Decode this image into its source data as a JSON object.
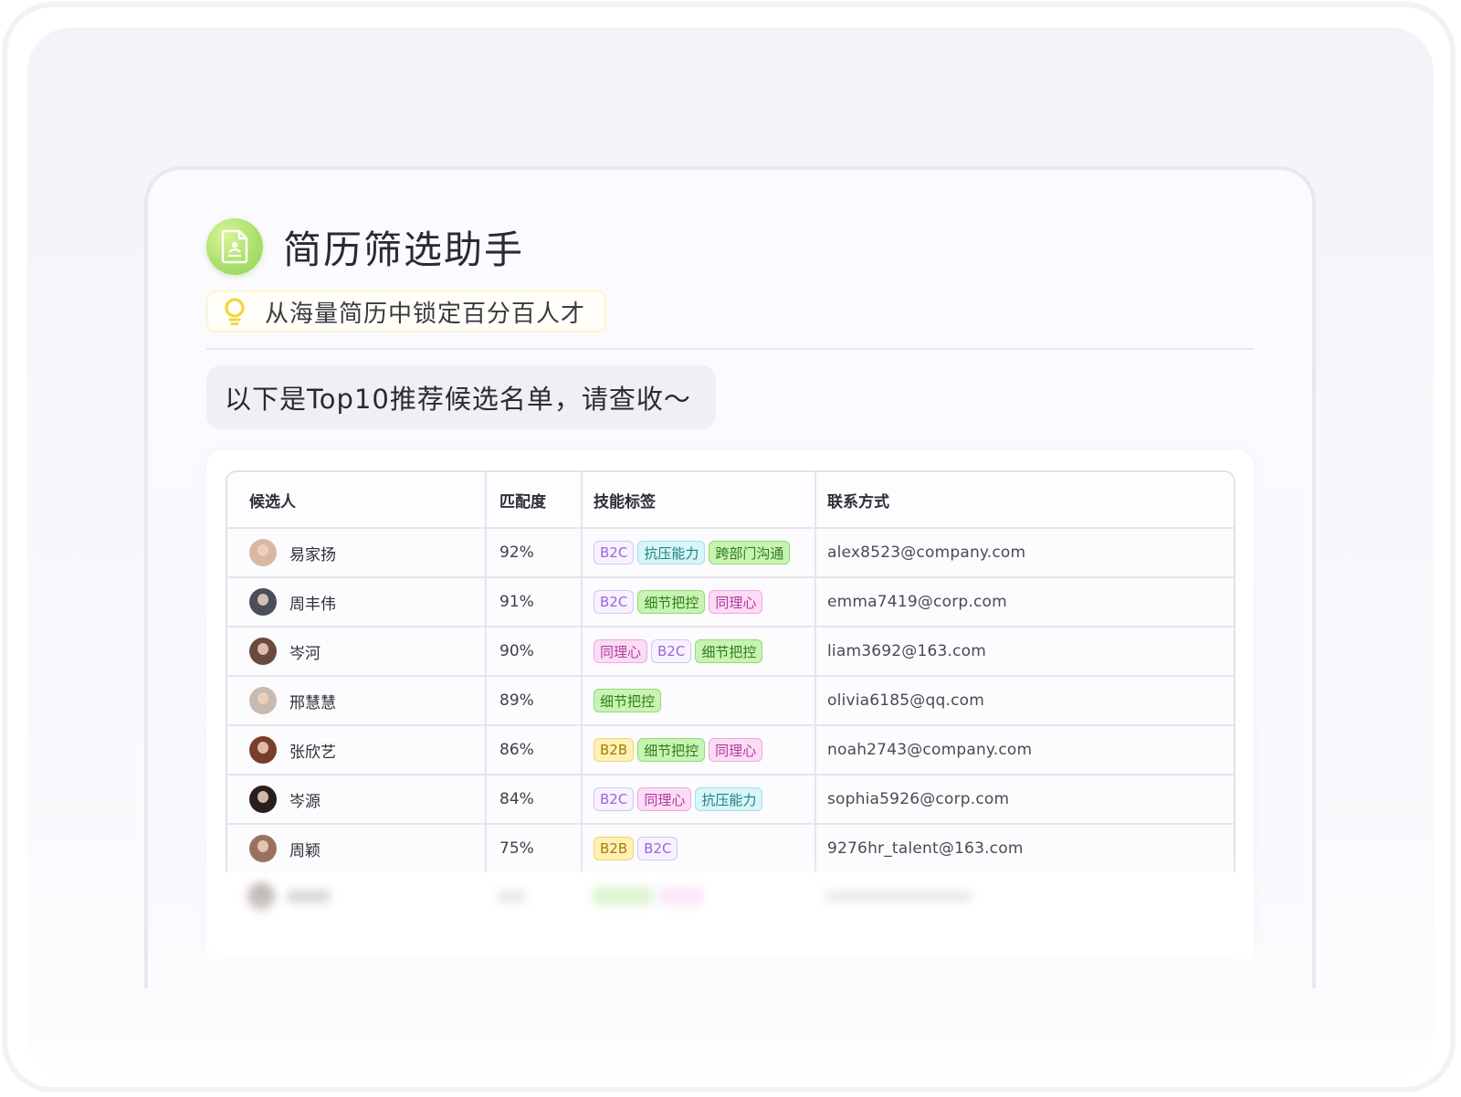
{
  "app": {
    "title": "简历筛选助手",
    "slogan": "从海量简历中锁定百分百人才",
    "message": "以下是Top10推荐候选名单，请查收～"
  },
  "table": {
    "headers": [
      "候选人",
      "匹配度",
      "技能标签",
      "联系方式"
    ],
    "rows": [
      {
        "name": "易家扬",
        "score": "92%",
        "tags": [
          "B2C",
          "抗压能力",
          "跨部门沟通"
        ],
        "email": "alex8523@company.com"
      },
      {
        "name": "周丰伟",
        "score": "91%",
        "tags": [
          "B2C",
          "细节把控",
          "同理心"
        ],
        "email": "emma7419@corp.com"
      },
      {
        "name": "岑河",
        "score": "90%",
        "tags": [
          "同理心",
          "B2C",
          "细节把控"
        ],
        "email": "liam3692@163.com"
      },
      {
        "name": "邢慧慧",
        "score": "89%",
        "tags": [
          "细节把控"
        ],
        "email": "olivia6185@qq.com"
      },
      {
        "name": "张欣艺",
        "score": "86%",
        "tags": [
          "B2B",
          "细节把控",
          "同理心"
        ],
        "email": "noah2743@company.com"
      },
      {
        "name": "岑源",
        "score": "84%",
        "tags": [
          "B2C",
          "同理心",
          "抗压能力"
        ],
        "email": "sophia5926@corp.com"
      },
      {
        "name": "周颖",
        "score": "75%",
        "tags": [
          "B2B",
          "B2C"
        ],
        "email": "9276hr_talent@163.com"
      }
    ]
  },
  "tag_colors": {
    "B2C": "purple",
    "B2B": "yellow",
    "抗压能力": "cyan",
    "跨部门沟通": "green",
    "细节把控": "green",
    "同理心": "pink"
  },
  "avatar_colors": [
    "#d9b8a3",
    "#4a4f5a",
    "#6a4a3e",
    "#c9b9b0",
    "#7a3d2c",
    "#2a1d1d",
    "#9c7060"
  ],
  "theme": {
    "accent_green": "#a8df6a",
    "bulb_yellow": "#f3d63a"
  }
}
